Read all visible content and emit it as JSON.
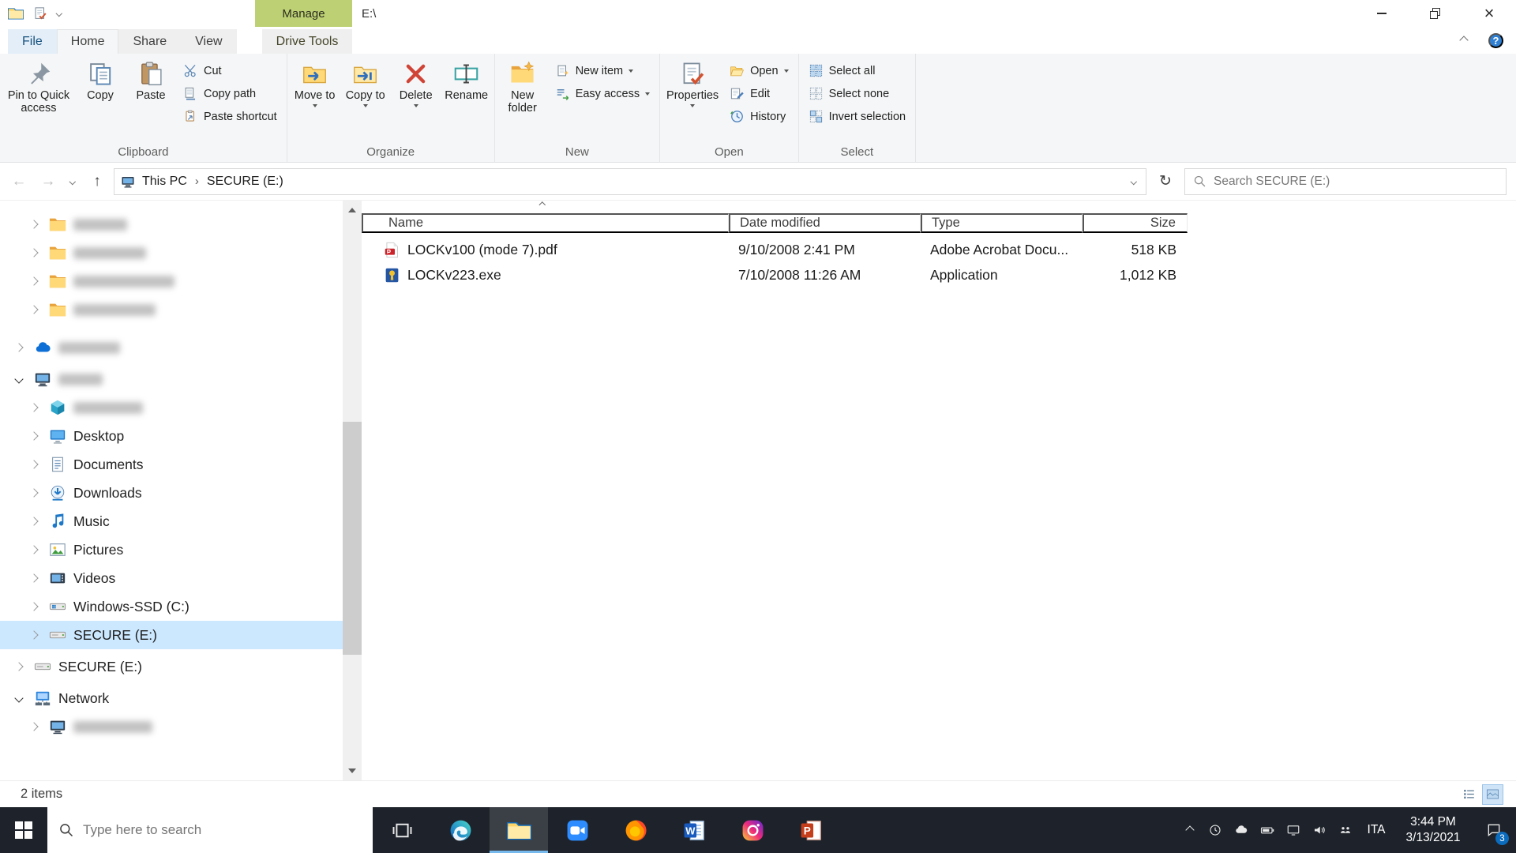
{
  "titlebar": {
    "title": "E:\\",
    "manage_label": "Manage"
  },
  "tabs": {
    "file": "File",
    "home": "Home",
    "share": "Share",
    "view": "View",
    "drive_tools": "Drive Tools"
  },
  "ribbon": {
    "clipboard": {
      "label": "Clipboard",
      "pin_to_quick_access": "Pin to Quick access",
      "copy": "Copy",
      "paste": "Paste",
      "cut": "Cut",
      "copy_path": "Copy path",
      "paste_shortcut": "Paste shortcut"
    },
    "organize": {
      "label": "Organize",
      "move_to": "Move to",
      "copy_to": "Copy to",
      "delete": "Delete",
      "rename": "Rename"
    },
    "new": {
      "label": "New",
      "new_folder": "New folder",
      "new_item": "New item",
      "easy_access": "Easy access"
    },
    "open": {
      "label": "Open",
      "properties": "Properties",
      "open": "Open",
      "edit": "Edit",
      "history": "History"
    },
    "select": {
      "label": "Select",
      "select_all": "Select all",
      "select_none": "Select none",
      "invert_selection": "Invert selection"
    }
  },
  "address": {
    "crumb_root": "This PC",
    "crumb_current": "SECURE (E:)",
    "search_placeholder": "Search SECURE (E:)"
  },
  "glyphs": {
    "back": "←",
    "forward": "→",
    "up": "↑",
    "refresh": "↻",
    "crumb_sep": "›",
    "close": "×",
    "help": "?"
  },
  "sidebar": {
    "items": [
      {
        "label": "",
        "redacted": true,
        "icon": "folder-icon"
      },
      {
        "label": "",
        "redacted": true,
        "icon": "folder-icon"
      },
      {
        "label": "",
        "redacted": true,
        "icon": "folder-icon"
      },
      {
        "label": "",
        "redacted": true,
        "icon": "folder-icon"
      },
      {
        "label": "",
        "redacted": true,
        "icon": "onedrive-cloud-icon"
      },
      {
        "label": "",
        "redacted": true,
        "icon": "this-pc-icon",
        "expanded": true
      },
      {
        "label": "",
        "redacted": true,
        "icon": "3d-objects-icon"
      },
      {
        "label": "Desktop",
        "icon": "desktop-icon"
      },
      {
        "label": "Documents",
        "icon": "documents-icon"
      },
      {
        "label": "Downloads",
        "icon": "downloads-icon"
      },
      {
        "label": "Music",
        "icon": "music-icon"
      },
      {
        "label": "Pictures",
        "icon": "pictures-icon"
      },
      {
        "label": "Videos",
        "icon": "videos-icon"
      },
      {
        "label": "Windows-SSD (C:)",
        "icon": "windows-drive-icon"
      },
      {
        "label": "SECURE (E:)",
        "icon": "drive-icon",
        "selected": true
      },
      {
        "label": "SECURE (E:)",
        "icon": "drive-icon"
      },
      {
        "label": "Network",
        "icon": "network-icon",
        "expanded": true
      },
      {
        "label": "",
        "redacted": true,
        "icon": "network-pc-icon"
      }
    ]
  },
  "file_list": {
    "columns": {
      "name": "Name",
      "date": "Date modified",
      "type": "Type",
      "size": "Size"
    },
    "rows": [
      {
        "name": "LOCKv100 (mode 7).pdf",
        "date_modified": "9/10/2008 2:41 PM",
        "type": "Adobe Acrobat Docu...",
        "size": "518 KB",
        "icon": "pdf-file-icon"
      },
      {
        "name": "LOCKv223.exe",
        "date_modified": "7/10/2008 11:26 AM",
        "type": "Application",
        "size": "1,012 KB",
        "icon": "exe-file-icon"
      }
    ]
  },
  "statusbar": {
    "items_count": "2 items"
  },
  "taskbar": {
    "search_placeholder": "Type here to search",
    "language": "ITA",
    "time": "3:44 PM",
    "date": "3/13/2021",
    "notification_badge": "3"
  }
}
